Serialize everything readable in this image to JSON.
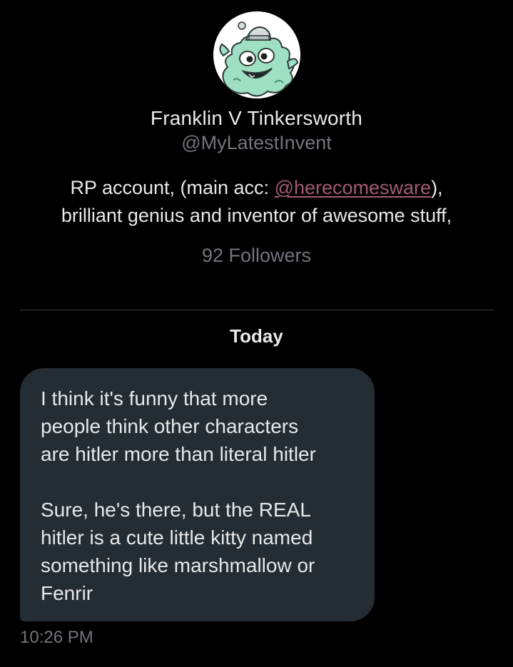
{
  "profile": {
    "avatar_icon": "teal-cartoon-creature-avatar-icon",
    "display_name": "Franklin V Tinkersworth",
    "handle": "@MyLatestInvent",
    "bio_prefix": "RP account, (main acc: ",
    "bio_mention": "@herecomesware",
    "bio_suffix": "),",
    "bio_line2": "brilliant genius and inventor of awesome stuff,",
    "followers": "92 Followers"
  },
  "conversation": {
    "date_separator": "Today",
    "messages": [
      {
        "paragraph1": "I think it's funny that more\npeople think other characters\nare hitler more than literal hitler",
        "paragraph2": "Sure, he's there, but the REAL\nhitler is a cute little kitty named\nsomething like marshmallow or\nFenrir",
        "time": "10:26 PM"
      }
    ]
  },
  "colors": {
    "background": "#000000",
    "primary_text": "#e7e9ea",
    "secondary_text": "#71767b",
    "mention": "#a35a78",
    "bubble": "#242d34",
    "divider": "#3a3d41"
  }
}
